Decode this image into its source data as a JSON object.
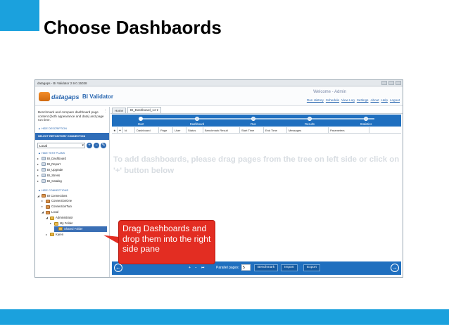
{
  "slide": {
    "title": "Choose Dashbaords",
    "callout": "Drag  Dashboards and drop them into the right side pane"
  },
  "window": {
    "title": "datagaps - BI Validator 2.9.0.15038",
    "logo_text": "datagaps",
    "app_name": "BI Validator",
    "welcome": "Welcome - Admin",
    "links": [
      "Run History",
      "Schedule",
      "View Log",
      "Settings",
      "About",
      "Help",
      "Logout"
    ]
  },
  "left": {
    "description": "Benchmark and compare dashboard page content (both appearance and data) and page run time.",
    "hide_description": "▲ HIDE DESCRIPTION",
    "repo_header": "SELECT REPOSITORY CONNECTION",
    "repo_value": "Local",
    "hide_test_plans": "▲ HIDE TEST PLANS",
    "test_plans": [
      "BI_Dashboard",
      "BI_Report",
      "BI_Upgrade",
      "BI_Stress",
      "BI_Catalog"
    ],
    "hide_connections": "▲ HIDE CONNECTIONS",
    "connections": {
      "root": "BI Connections",
      "items": [
        "ConnectionOne",
        "ConnectionTwo",
        "Local",
        "Administrator",
        "My Folder",
        "Shared Folder",
        "Karen"
      ]
    }
  },
  "right": {
    "tabs": [
      "Home",
      "BI_Dashboard_14"
    ],
    "wizard_steps": [
      "Start",
      "Dashboard",
      "Run",
      "Results",
      "Statistics"
    ],
    "columns": [
      "Id",
      "Dashboard",
      "Page",
      "User",
      "Status",
      "Benchmark Result",
      "Start Time",
      "End Time",
      "Messages",
      "Parameters"
    ],
    "empty_message": "To add dashboards, please drag pages from the tree on left side or click on '+' button below",
    "footer": {
      "add": "+",
      "remove": "−",
      "first": "⏮",
      "parallel_label": "Parallel pages:",
      "parallel_value": "5",
      "buttons": [
        "Benchmark",
        "Import",
        "Export"
      ]
    }
  },
  "colors": {
    "accent": "#1ba1dd",
    "nav": "#1f6fbf",
    "callout": "#e32d22"
  }
}
